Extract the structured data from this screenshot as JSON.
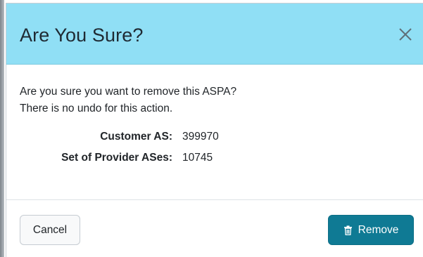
{
  "dialog": {
    "title": "Are You Sure?",
    "header_color": "#90dff5"
  },
  "body": {
    "message_line_1": "Are you sure you want to remove this ASPA?",
    "message_line_2": "There is no undo for this action.",
    "details": [
      {
        "label": "Customer AS:",
        "value": "399970"
      },
      {
        "label": "Set of Provider ASes:",
        "value": "10745"
      }
    ]
  },
  "footer": {
    "cancel_label": "Cancel",
    "remove_label": "Remove",
    "remove_icon": "trash-icon",
    "remove_color": "#0f7a94"
  },
  "icons": {
    "close": "close-icon"
  }
}
